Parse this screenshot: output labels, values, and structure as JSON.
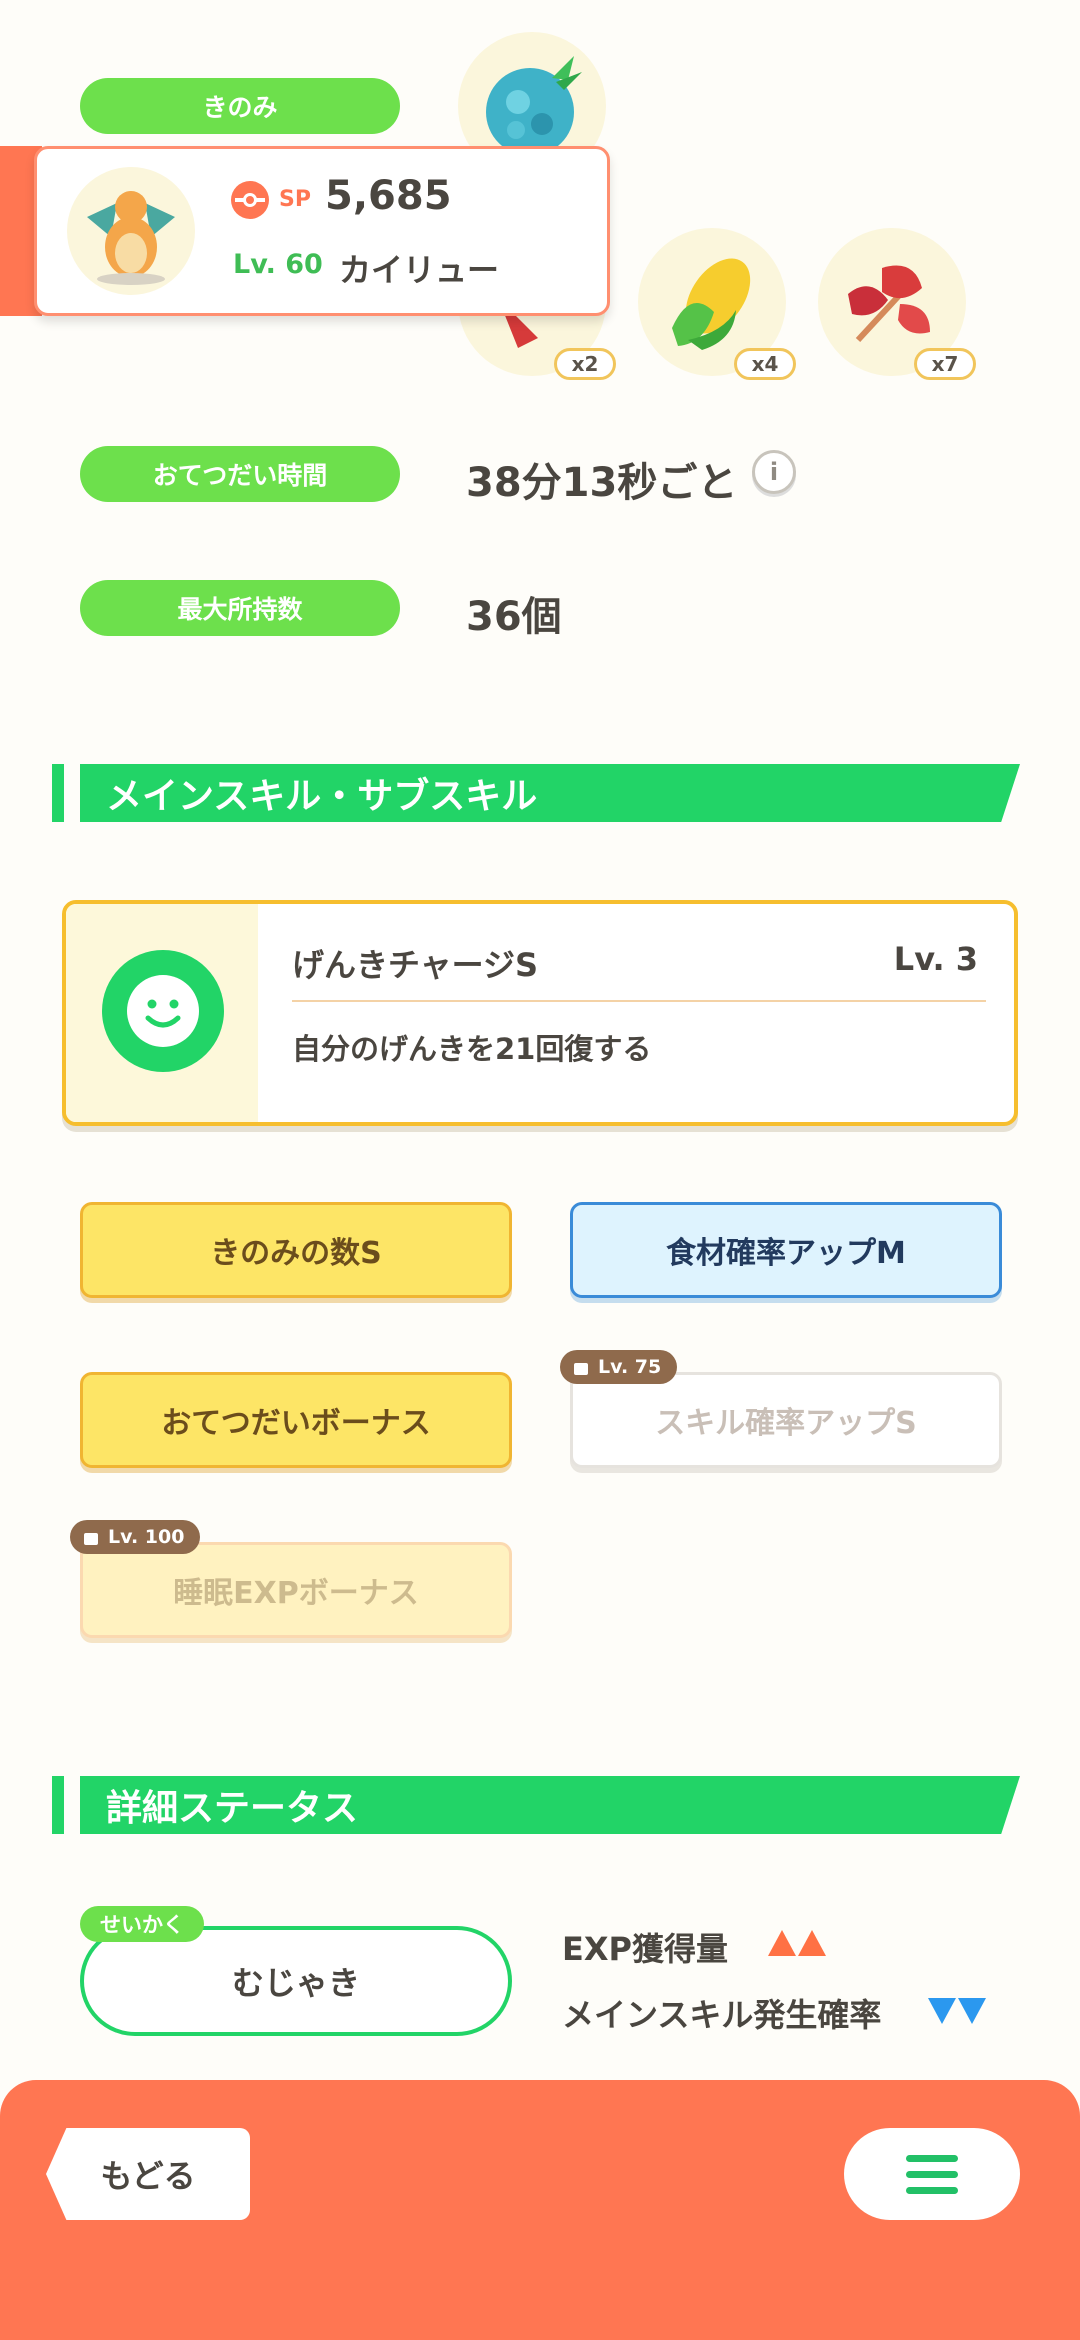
{
  "berry": {
    "label": "きのみ"
  },
  "ingredients": {
    "counts": [
      "x2",
      "x4",
      "x7"
    ]
  },
  "pokemon_card": {
    "sp_label": "SP",
    "sp_value": "5,685",
    "level": "Lv. 60",
    "name": "カイリュー"
  },
  "help_time": {
    "label": "おてつだい時間",
    "value": "38分13秒ごと"
  },
  "max_carry": {
    "label": "最大所持数",
    "value": "36個"
  },
  "skills_section": {
    "title": "メインスキル・サブスキル"
  },
  "main_skill": {
    "name": "げんきチャージS",
    "level": "Lv. 3",
    "description": "自分のげんきを21回復する"
  },
  "sub_skills": [
    {
      "name": "きのみの数S",
      "lock_level": null
    },
    {
      "name": "食材確率アップM",
      "lock_level": null
    },
    {
      "name": "おてつだいボーナス",
      "lock_level": null
    },
    {
      "name": "スキル確率アップS",
      "lock_level": "Lv. 75"
    },
    {
      "name": "睡眠EXPボーナス",
      "lock_level": "Lv. 100"
    }
  ],
  "status_section": {
    "title": "詳細ステータス"
  },
  "nature": {
    "tag": "せいかく",
    "value": "むじゃき",
    "up_effect": "EXP獲得量",
    "down_effect": "メインスキル発生確率"
  },
  "bottom_bar": {
    "back_label": "もどる",
    "menu_icon": "hamburger-menu-icon"
  },
  "colors": {
    "accent_green": "#22d467",
    "pill_green": "#6de04c",
    "bottom_orange": "#ff7652"
  }
}
